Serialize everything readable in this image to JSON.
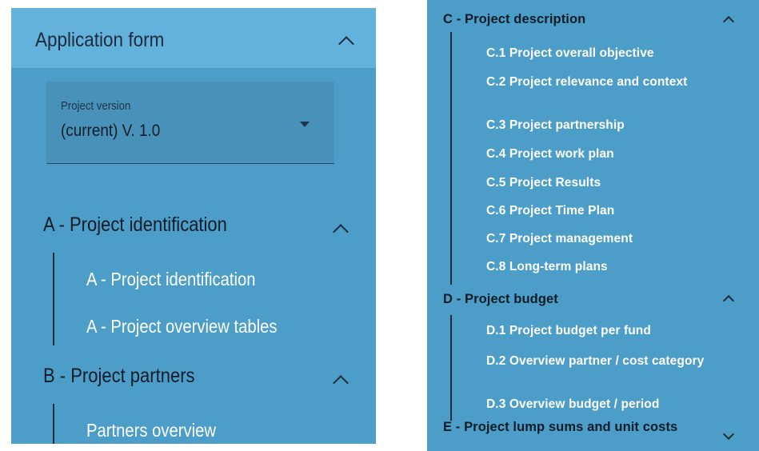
{
  "left": {
    "header_title": "Application form",
    "version": {
      "label": "Project version",
      "value": "(current) V. 1.0"
    },
    "sections": [
      {
        "title": "A - Project identification",
        "items": [
          "A - Project identification",
          "A - Project overview tables"
        ]
      },
      {
        "title": "B - Project partners",
        "items": [
          "Partners overview"
        ]
      }
    ]
  },
  "right": {
    "sections": [
      {
        "title": "C - Project description",
        "items": [
          "C.1 Project overall objective",
          "C.2 Project relevance and context",
          "C.3 Project partnership",
          "C.4 Project work plan",
          "C.5 Project Results",
          "C.6 Project Time Plan",
          "C.7 Project management",
          "C.8 Long-term plans"
        ]
      },
      {
        "title": "D - Project budget",
        "items": [
          "D.1 Project budget per fund",
          "D.2 Overview partner / cost category",
          "D.3 Overview budget / period"
        ]
      },
      {
        "title": "E - Project lump sums and unit costs",
        "items": []
      }
    ]
  },
  "colors": {
    "panel_bg": "#4c9ec8",
    "header_bg": "#63b2dc",
    "select_bg": "#4891b8",
    "dark_text": "#0f1c28",
    "light_text": "#ffffff"
  },
  "icons": {
    "expand": "chevron-up-icon",
    "collapse": "chevron-down-icon",
    "dropdown": "caret-down-icon"
  }
}
